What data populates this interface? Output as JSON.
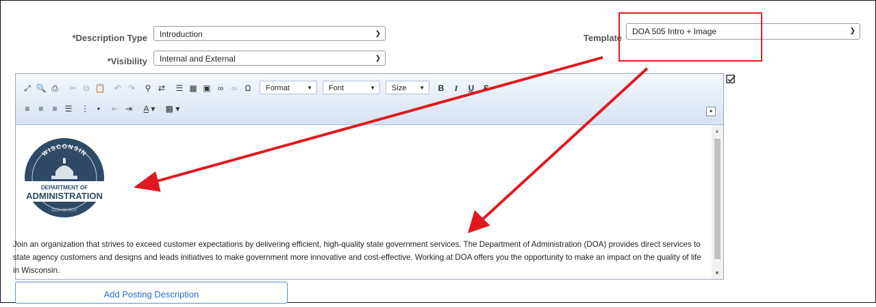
{
  "form": {
    "description_type": {
      "label": "*Description Type",
      "value": "Introduction"
    },
    "visibility": {
      "label": "*Visibility",
      "value": "Internal and External"
    },
    "template": {
      "label": "Template",
      "value": "DOA 505 Intro + Image"
    }
  },
  "toolbar": {
    "format_label": "Format",
    "font_label": "Font",
    "size_label": "Size",
    "bold": "B",
    "italic": "I",
    "underline": "U",
    "strike": "S"
  },
  "logo": {
    "top_text": "WISCONSIN",
    "line1": "DEPARTMENT OF",
    "line2": "ADMINISTRATION",
    "bottom_text": "DOA.WI.GOV"
  },
  "body_text": "Join an organization that strives to exceed customer expectations by delivering efficient, high-quality state government services. The Department of Administration (DOA) provides direct services to state agency customers and designs and leads initiatives to make government more innovative and cost-effective. Working at DOA offers you the opportunity to make an impact on the quality of life in Wisconsin.",
  "add_button": "Add Posting Description",
  "colors": {
    "annotation": "#e0191e",
    "link": "#2a6cc2"
  },
  "icons": [
    "maximize-icon",
    "preview-icon",
    "print-icon",
    "cut-icon",
    "copy-icon",
    "paste-icon",
    "undo-icon",
    "redo-icon",
    "find-icon",
    "replace-icon",
    "horizontal-line-icon",
    "table-icon",
    "image-icon",
    "link-icon",
    "unlink-icon",
    "special-char-icon",
    "align-left-icon",
    "align-center-icon",
    "align-right-icon",
    "justify-icon",
    "numbered-list-icon",
    "bulleted-list-icon",
    "outdent-icon",
    "indent-icon",
    "text-color-icon",
    "background-color-icon",
    "collapse-toolbar-icon",
    "spellcheck-icon"
  ]
}
